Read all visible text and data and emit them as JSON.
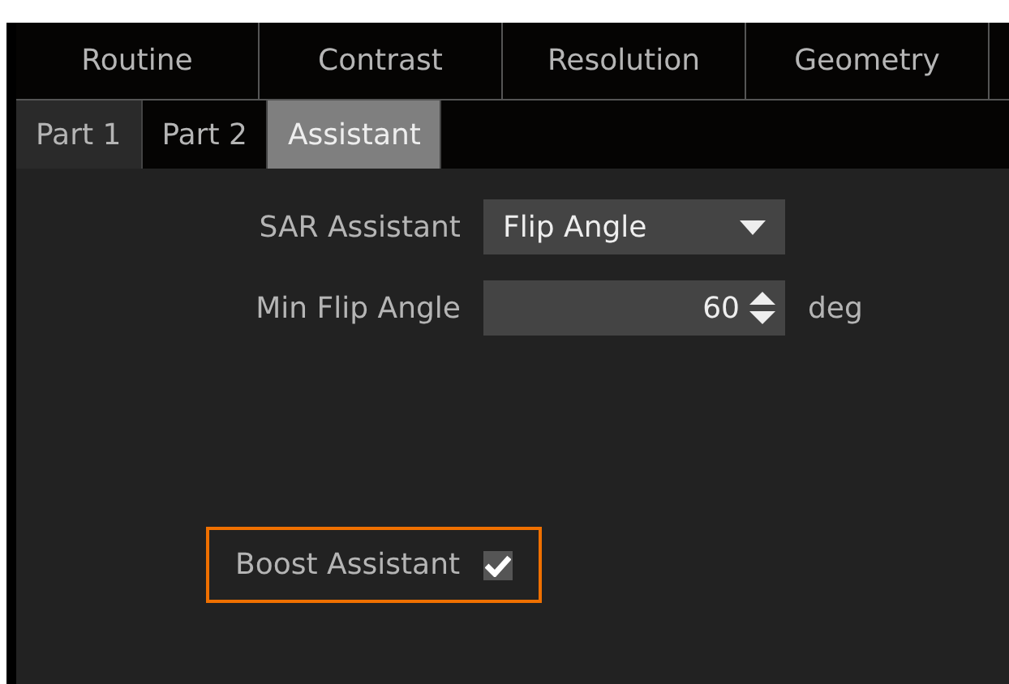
{
  "main_tabs": [
    {
      "label": "Routine",
      "selected": false
    },
    {
      "label": "Contrast",
      "selected": false
    },
    {
      "label": "Resolution",
      "selected": false
    },
    {
      "label": "Geometry",
      "selected": false
    }
  ],
  "sub_tabs": [
    {
      "label": "Part 1",
      "selected": false
    },
    {
      "label": "Part 2",
      "selected": false
    },
    {
      "label": "Assistant",
      "selected": true
    }
  ],
  "fields": [
    {
      "kind": "dropdown",
      "label": "SAR Assistant",
      "value": "Flip Angle"
    },
    {
      "kind": "spinner",
      "label": "Min Flip Angle",
      "value": "60",
      "unit": "deg"
    }
  ],
  "boost": {
    "label": "Boost Assistant",
    "checked": true,
    "highlighted": true
  }
}
